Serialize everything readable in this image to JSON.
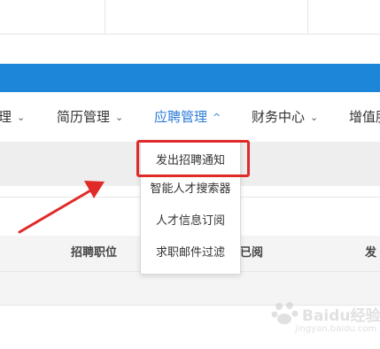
{
  "nav": {
    "items": [
      {
        "label": "理",
        "chevron": "⌄"
      },
      {
        "label": "简历管理",
        "chevron": "⌄"
      },
      {
        "label": "应聘管理",
        "chevron": "^"
      },
      {
        "label": "财务中心",
        "chevron": "⌄"
      },
      {
        "label": "增值服"
      }
    ]
  },
  "dropdown": {
    "items": [
      "发出招聘通知",
      "智能人才搜索器",
      "人才信息订阅",
      "求职邮件过滤"
    ]
  },
  "table": {
    "headers": [
      "招聘职位",
      "否已阅",
      "发"
    ]
  },
  "colors": {
    "accent": "#1e86d8",
    "active_nav": "#2b7bd8",
    "highlight": "#e02a2a"
  },
  "watermark": {
    "text": "Baidu经验",
    "sub": "jingyan.baidu.com"
  }
}
